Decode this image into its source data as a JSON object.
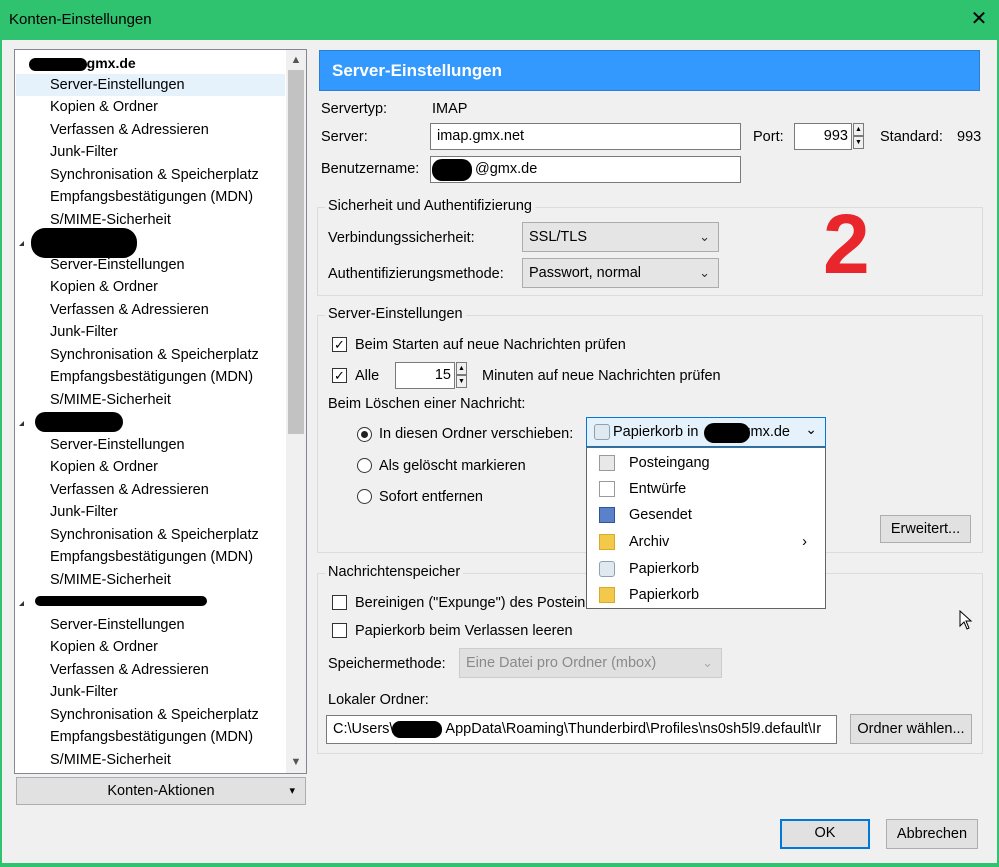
{
  "window": {
    "title": "Konten-Einstellungen",
    "close_glyph": "✕"
  },
  "tree": {
    "accounts": [
      {
        "name": "@gmx.de",
        "items": [
          "Server-Einstellungen",
          "Kopien & Ordner",
          "Verfassen & Adressieren",
          "Junk-Filter",
          "Synchronisation & Speicherplatz",
          "Empfangsbestätigungen (MDN)",
          "S/MIME-Sicherheit"
        ]
      },
      {
        "name": "",
        "items": [
          "Server-Einstellungen",
          "Kopien & Ordner",
          "Verfassen & Adressieren",
          "Junk-Filter",
          "Synchronisation & Speicherplatz",
          "Empfangsbestätigungen (MDN)",
          "S/MIME-Sicherheit"
        ]
      },
      {
        "name": "",
        "items": [
          "Server-Einstellungen",
          "Kopien & Ordner",
          "Verfassen & Adressieren",
          "Junk-Filter",
          "Synchronisation & Speicherplatz",
          "Empfangsbestätigungen (MDN)",
          "S/MIME-Sicherheit"
        ]
      },
      {
        "name": "",
        "items": [
          "Server-Einstellungen",
          "Kopien & Ordner",
          "Verfassen & Adressieren",
          "Junk-Filter",
          "Synchronisation & Speicherplatz",
          "Empfangsbestätigungen (MDN)",
          "S/MIME-Sicherheit"
        ]
      }
    ],
    "scroll_up": "▲",
    "scroll_down": "▼"
  },
  "account_actions": {
    "label": "Konten-Aktionen",
    "arrow": "▾"
  },
  "panel": {
    "header": "Server-Einstellungen",
    "servertype_label": "Servertyp:",
    "servertype_value": "IMAP",
    "server_label": "Server:",
    "server_value": "imap.gmx.net",
    "port_label": "Port:",
    "port_value": "993",
    "standard_label": "Standard:",
    "standard_value": "993",
    "username_label": "Benutzername:",
    "username_value": "@gmx.de"
  },
  "security": {
    "legend": "Sicherheit und Authentifizierung",
    "connection_label": "Verbindungssicherheit:",
    "connection_value": "SSL/TLS",
    "auth_label": "Authentifizierungsmethode:",
    "auth_value": "Passwort, normal"
  },
  "annotation": "2",
  "server_settings": {
    "legend": "Server-Einstellungen",
    "check_on_start": "Beim Starten auf neue Nachrichten prüfen",
    "every_label": "Alle",
    "every_value": "15",
    "minutes_label": "Minuten auf neue Nachrichten prüfen",
    "on_delete_label": "Beim Löschen einer Nachricht:",
    "move_to_folder": "In diesen Ordner verschieben:",
    "mark_deleted": "Als gelöscht markieren",
    "remove_now": "Sofort entfernen",
    "advanced_button": "Erweitert...",
    "checkmark": "✓"
  },
  "folder_dropdown": {
    "selected_prefix": "Papierkorb in",
    "selected_suffix": "gmx.de",
    "chevron": "⌄",
    "items": [
      {
        "label": "Posteingang",
        "icon": "inbox-icon"
      },
      {
        "label": "Entwürfe",
        "icon": "drafts-icon"
      },
      {
        "label": "Gesendet",
        "icon": "sent-icon"
      },
      {
        "label": "Archiv",
        "icon": "folder-icon",
        "submenu": "›"
      },
      {
        "label": "Papierkorb",
        "icon": "trash-icon"
      },
      {
        "label": "Papierkorb",
        "icon": "folder-icon"
      }
    ]
  },
  "storage": {
    "legend": "Nachrichtenspeicher",
    "expunge_label": "Bereinigen (\"Expunge\") des Postein",
    "empty_trash_label": "Papierkorb beim Verlassen leeren",
    "method_label": "Speichermethode:",
    "method_value": "Eine Datei pro Ordner (mbox)",
    "local_folder_label": "Lokaler Ordner:",
    "path_prefix": "C:\\Users\\",
    "path_suffix": "AppData\\Roaming\\Thunderbird\\Profiles\\ns0sh5l9.default\\Ir",
    "choose_folder_button": "Ordner wählen..."
  },
  "footer": {
    "ok": "OK",
    "cancel": "Abbrechen"
  }
}
